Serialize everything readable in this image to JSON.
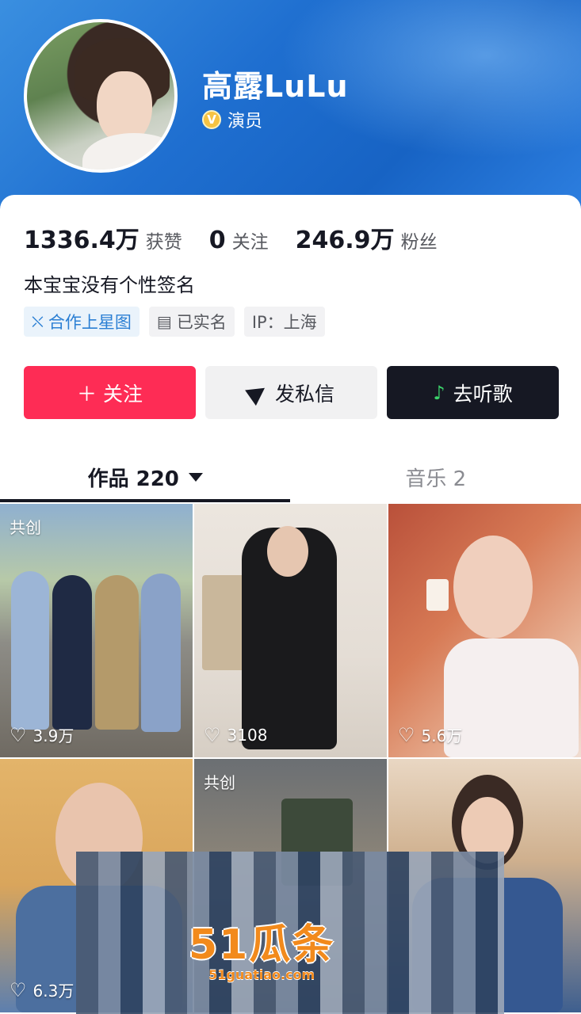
{
  "profile": {
    "name": "高露LuLu",
    "role_badge": "V",
    "role": "演员",
    "bio": "本宝宝没有个性签名"
  },
  "stats": [
    {
      "value": "1336.4万",
      "label": "获赞"
    },
    {
      "value": "0",
      "label": "关注"
    },
    {
      "value": "246.9万",
      "label": "粉丝"
    }
  ],
  "tags": [
    {
      "icon": "star-map-icon",
      "label": "合作上星图"
    },
    {
      "icon": "id-card-icon",
      "label": "已实名"
    },
    {
      "label": "IP：上海"
    }
  ],
  "actions": {
    "follow": "＋ 关注",
    "message": "发私信",
    "music": "去听歌"
  },
  "tabs": {
    "works": "作品 220",
    "music": "音乐 2"
  },
  "videos": [
    {
      "cotag": "共创",
      "likes": "3.9万"
    },
    {
      "cotag": "",
      "likes": "3108"
    },
    {
      "cotag": "",
      "likes": "5.6万"
    },
    {
      "cotag": "",
      "likes": "6.3万"
    },
    {
      "cotag": "共创",
      "likes": ""
    },
    {
      "cotag": "",
      "likes": ""
    }
  ],
  "watermark": {
    "logo": "51瓜条",
    "url": "51guatiao.com"
  },
  "colors": {
    "follow_button": "#fe2c55",
    "music_button": "#161823",
    "header_blue": "#1f6fd0",
    "verified_gold": "#f6c343"
  }
}
